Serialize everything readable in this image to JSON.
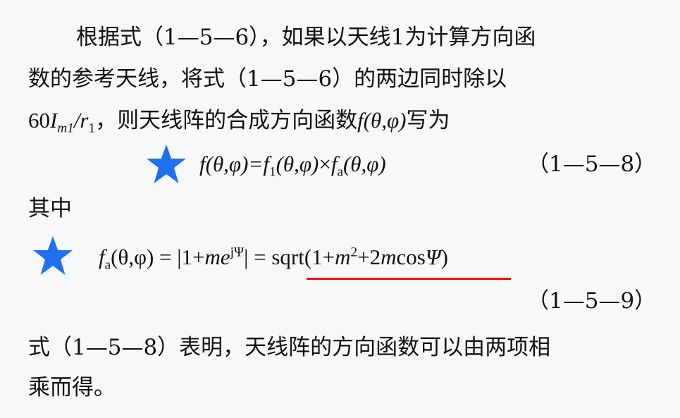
{
  "paragraph1": {
    "line1": "根据式（1—5—6），如果以天线1为计算方向函",
    "line2": "数的参考天线，将式（1—5—6）的两边同时除以",
    "line3_prefix": "60",
    "line3_I": "I",
    "line3_sub_m1": "m1",
    "line3_slash_r": "/r",
    "line3_sub_1": "1",
    "line3_text": "，则天线阵的合成方向函数",
    "line3_f": "f",
    "line3_args": "(θ,φ)",
    "line3_suffix": "写为"
  },
  "equation1": {
    "lhs_f": "f",
    "lhs_args": "(θ,φ)=",
    "f1": "f",
    "f1_sub": "1",
    "f1_args": "(θ,φ)",
    "times": "×",
    "fa": "f",
    "fa_sub": "a",
    "fa_args": "(θ,φ)",
    "number": "（1—5—8）"
  },
  "qizhong": "其中",
  "equation2": {
    "fa": "f",
    "fa_sub": "a",
    "args": "(θ,φ) = |1+",
    "m": "me",
    "exp": "jΨ",
    "mid": "| = ",
    "sqrt_open": "sqrt(1+",
    "m2": "m",
    "sq": "2",
    "plus": "+2",
    "m3": "m",
    "cos": "cos",
    "psi": "Ψ",
    "close": ")",
    "number": "（1—5—9）"
  },
  "paragraph2": {
    "line1": "式（1—5—8）表明，天线阵的方向函数可以由两项相",
    "line2": "乘而得。"
  },
  "colors": {
    "star": "#1f6ff2",
    "underline": "#ee1111",
    "background": "#f7f8fa"
  },
  "icons": {
    "star": "star-icon"
  }
}
